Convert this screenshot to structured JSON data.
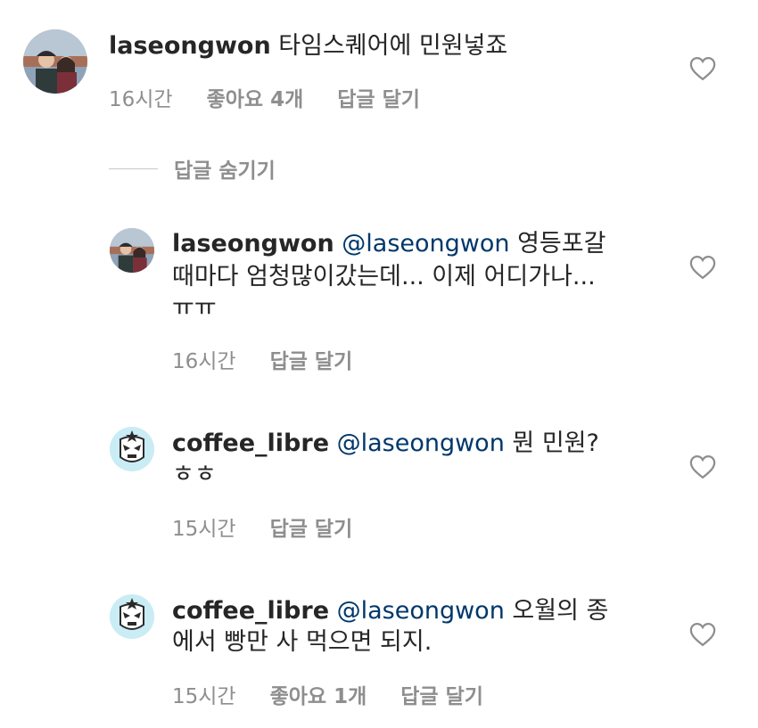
{
  "colors": {
    "text": "#262626",
    "secondary": "#8e8e8e",
    "mention": "#00376b",
    "divider": "#c7c7c7"
  },
  "comments": [
    {
      "username": "laseongwon",
      "text": "타임스퀘어에 민원넣죠",
      "time": "16시간",
      "likes": "좋아요 4개",
      "reply": "답글 달기",
      "avatar": "couple-photo-avatar",
      "like_icon": "heart-outline-icon"
    }
  ],
  "hide_replies": "답글 숨기기",
  "replies": [
    {
      "username": "laseongwon",
      "mention": "@laseongwon",
      "text_lines": [
        "영등포갈",
        "때마다 엄청많이갔는데... 이제 어디가나...",
        "ㅠㅠ"
      ],
      "time": "16시간",
      "reply": "답글 달기",
      "avatar": "couple-photo-avatar",
      "like_icon": "heart-outline-icon"
    },
    {
      "username": "coffee_libre",
      "mention": "@laseongwon",
      "text_lines": [
        "뭔 민원?",
        "ㅎㅎ"
      ],
      "time": "15시간",
      "reply": "답글 달기",
      "avatar": "luchador-mask-avatar",
      "like_icon": "heart-outline-icon"
    },
    {
      "username": "coffee_libre",
      "mention": "@laseongwon",
      "text_lines": [
        "오월의 종",
        "에서 빵만 사 먹으면 되지."
      ],
      "time": "15시간",
      "likes": "좋아요 1개",
      "reply": "답글 달기",
      "avatar": "luchador-mask-avatar",
      "like_icon": "heart-outline-icon"
    }
  ]
}
